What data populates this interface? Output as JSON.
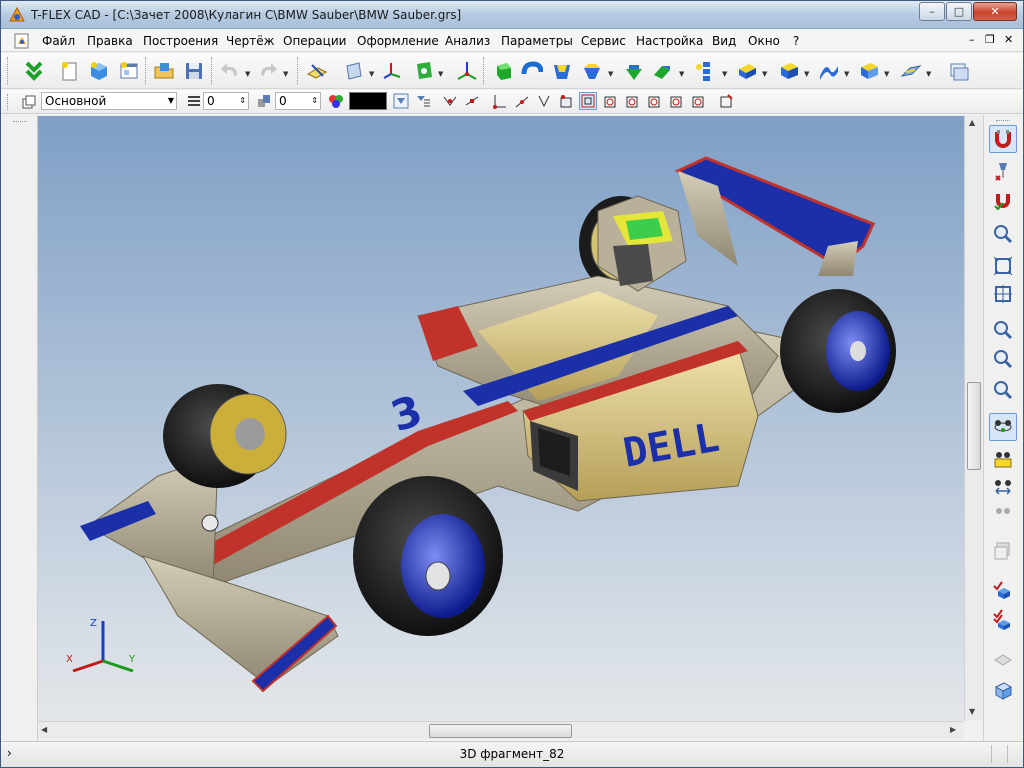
{
  "window": {
    "title": "T-FLEX CAD - [C:\\Зачет 2008\\Кулагин С\\BMW Sauber\\BMW Sauber.grs]",
    "controls": {
      "minimize": "–",
      "maximize": "□",
      "close": "✕"
    }
  },
  "menu": {
    "items": [
      "Файл",
      "Правка",
      "Построения",
      "Чертёж",
      "Операции",
      "Оформление",
      "Анализ",
      "Параметры",
      "Сервис",
      "Настройка",
      "Вид",
      "Окно",
      "?"
    ],
    "mdi_controls": {
      "minimize": "–",
      "restore": "❐",
      "close": "✕"
    }
  },
  "toolbar2": {
    "layer_value": "Основной",
    "level_value": "0",
    "priority_value": "0",
    "color_swatch": "#000000"
  },
  "model": {
    "car_number": "3",
    "sponsor_text": "DELL"
  },
  "axes": {
    "x": "X",
    "y": "Y",
    "z": "Z"
  },
  "status": {
    "text": "3D фрагмент_82",
    "chevron": "›"
  },
  "colors": {
    "accent_blue": "#1a2fa8",
    "body_silver": "#b9b09a",
    "stripe_red": "#c0322a",
    "tire_black": "#1b1b1b"
  }
}
